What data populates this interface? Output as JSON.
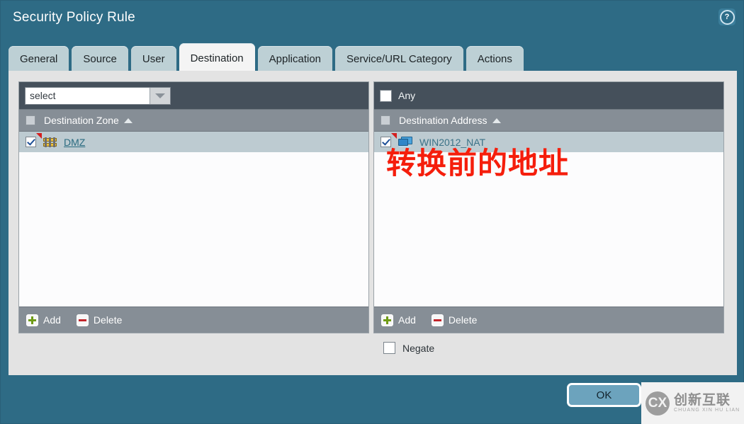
{
  "dialog": {
    "title": "Security Policy Rule",
    "help_icon": "help-question-icon"
  },
  "tabs": [
    {
      "label": "General",
      "active": false
    },
    {
      "label": "Source",
      "active": false
    },
    {
      "label": "User",
      "active": false
    },
    {
      "label": "Destination",
      "active": true
    },
    {
      "label": "Application",
      "active": false
    },
    {
      "label": "Service/URL Category",
      "active": false
    },
    {
      "label": "Actions",
      "active": false
    }
  ],
  "destination_zone_panel": {
    "select": {
      "value": "select",
      "placeholder": "select",
      "arrow_icon": "chevron-down-icon"
    },
    "column_header": "Destination Zone",
    "sort_indicator": "sort-ascending-icon",
    "header_checkbox_checked": false,
    "rows": [
      {
        "label": "DMZ",
        "icon": "zone-barrier-icon",
        "checked": true,
        "flagged": true
      }
    ],
    "footer": {
      "add_label": "Add",
      "add_icon": "plus-icon",
      "delete_label": "Delete",
      "delete_icon": "minus-icon"
    }
  },
  "destination_address_panel": {
    "any": {
      "label": "Any",
      "checked": false
    },
    "column_header": "Destination Address",
    "sort_indicator": "sort-ascending-icon",
    "header_checkbox_checked": false,
    "rows": [
      {
        "label": "WIN2012_NAT",
        "icon": "host-monitor-icon",
        "checked": true,
        "flagged": true
      }
    ],
    "annotation": "转换前的地址",
    "footer": {
      "add_label": "Add",
      "add_icon": "plus-icon",
      "delete_label": "Delete",
      "delete_icon": "minus-icon"
    }
  },
  "negate": {
    "label": "Negate",
    "checked": false
  },
  "footer": {
    "ok_label": "OK"
  },
  "watermark": {
    "mark": "CX",
    "chinese": "创新互联",
    "pinyin": "CHUANG XIN HU LIAN"
  },
  "colors": {
    "dialog_chrome": "#2e6b85",
    "tab_inactive": "#bdd0d5",
    "tab_active": "#f4f4f4",
    "panel_header_dark": "#45505b",
    "column_header": "#868e96",
    "row_selected": "#bdcbd1",
    "link_text": "#2a6b80",
    "annotation_red": "#f51e0c",
    "ok_button": "#6ca3bd"
  }
}
